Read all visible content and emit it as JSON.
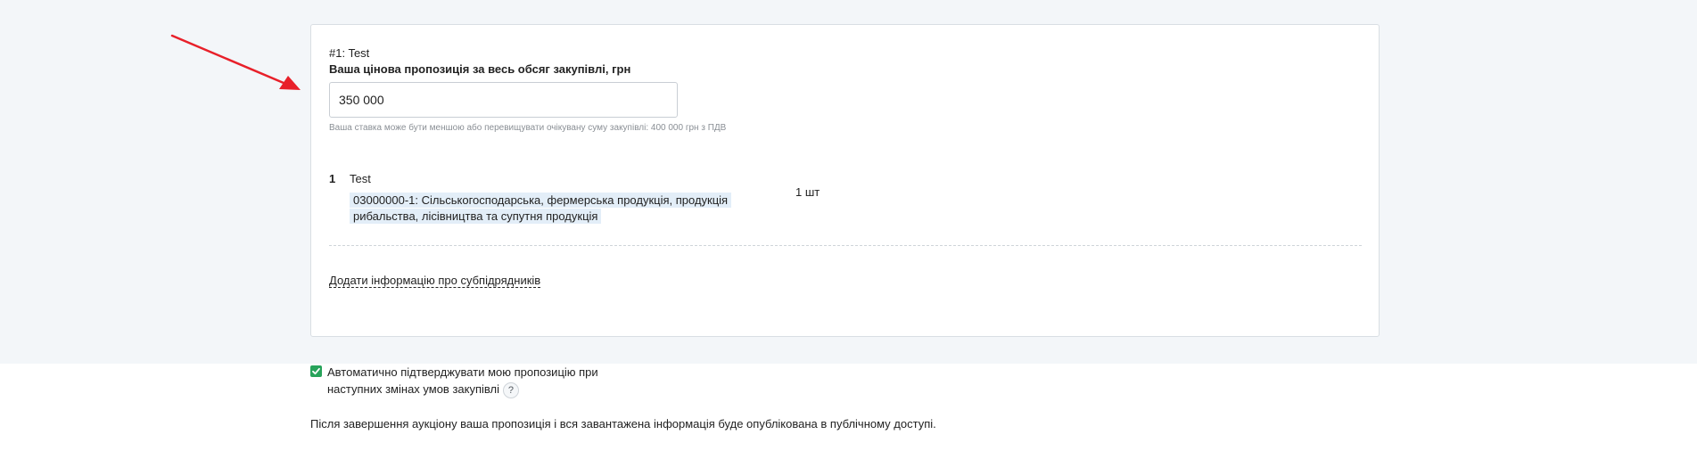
{
  "lot": {
    "title": "#1: Test",
    "price_label": "Ваша цінова пропозиція за весь обсяг закупівлі, грн",
    "price_value": "350 000",
    "price_hint": "Ваша ставка може бути меншою або перевищувати очікувану суму закупівлі: 400 000 грн з ПДВ",
    "items": [
      {
        "number": "1",
        "name": "Test",
        "classifier": "03000000-1: Сільськогосподарська, фермерська продукція, продукція рибальства, лісівництва та супутня продукція",
        "quantity": "1 шт"
      }
    ],
    "subcontractor_link": "Додати інформацію про субпідрядників"
  },
  "auto_confirm": {
    "checked": true,
    "label": "Автоматично підтверджувати мою пропозицію при наступних змінах умов закупівлі",
    "help": "?"
  },
  "publication_note": "Після завершення аукціону ваша пропозиція і вся завантажена інформація буде опублікована в публічному доступі.",
  "colors": {
    "annotation_arrow": "#e8202a",
    "checkbox": "#27a35a",
    "classifier_highlight": "#e3eef8",
    "background": "#f3f6f9"
  },
  "icons": {
    "arrow": "red-annotation-arrow-icon",
    "checkbox": "checkmark-icon",
    "help": "question-mark-icon"
  }
}
